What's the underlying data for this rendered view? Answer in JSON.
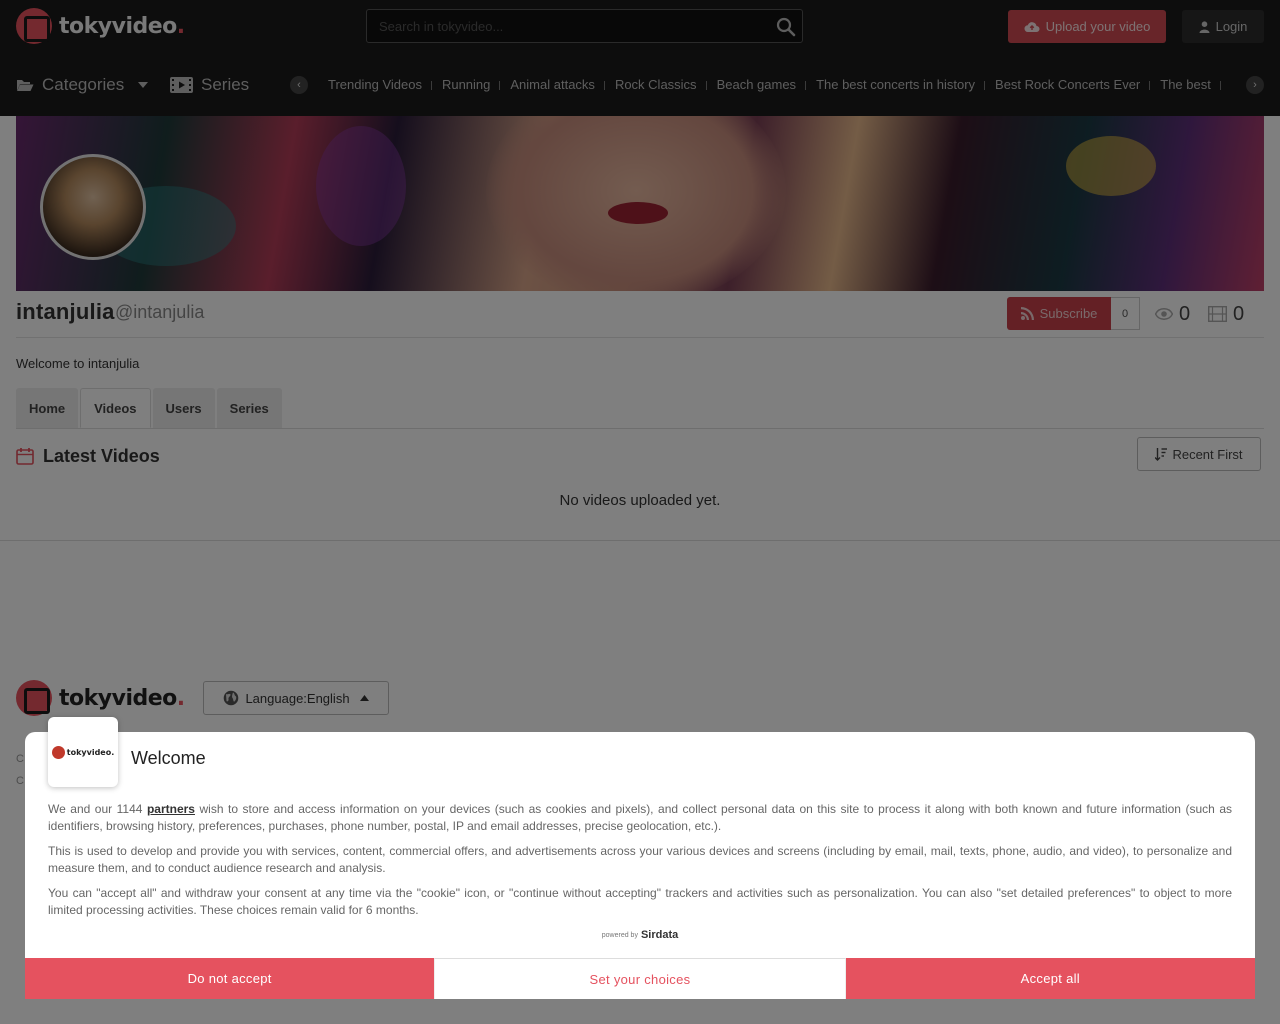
{
  "header": {
    "logo_text": "tokyvideo",
    "logo_dot": ".",
    "search_placeholder": "Search in tokyvideo...",
    "upload_label": "Upload your video",
    "login_label": "Login",
    "categories_label": "Categories",
    "series_label": "Series",
    "chips": [
      "Trending Videos",
      "Running",
      "Animal attacks",
      "Rock Classics",
      "Beach games",
      "The best concerts in history",
      "Best Rock Concerts Ever",
      "The best"
    ]
  },
  "profile": {
    "name": "intanjulia",
    "handle": "@intanjulia",
    "subscribe_label": "Subscribe",
    "subscriber_count": "0",
    "views_count": "0",
    "videos_count": "0",
    "welcome_text": "Welcome to intanjulia"
  },
  "tabs": [
    {
      "label": "Home",
      "active": false
    },
    {
      "label": "Videos",
      "active": true
    },
    {
      "label": "Users",
      "active": false
    },
    {
      "label": "Series",
      "active": false
    }
  ],
  "content": {
    "section_title": "Latest Videos",
    "sort_label": "Recent First",
    "empty_text": "No videos uploaded yet."
  },
  "footer": {
    "language_prefix": "Language:",
    "language_value": "English",
    "line1": "C",
    "line2": "C"
  },
  "consent": {
    "logo_text": "tokyvideo.",
    "title": "Welcome",
    "p1_before": "We and our 1144 ",
    "p1_link": "partners",
    "p1_after": " wish to store and access information on your devices (such as cookies and pixels), and collect personal data on this site to process it along with both known and future information (such as identifiers, browsing history, preferences, purchases, phone number, postal, IP and email addresses, precise geolocation, etc.).",
    "p2": "This is used to develop and provide you with services, content, commercial offers, and advertisements across your various devices and screens (including by email, mail, texts, phone, audio, and video), to personalize and measure them, and to conduct audience research and analysis.",
    "p3": "You can \"accept all\" and withdraw your consent at any time via the \"cookie\" icon, or \"continue without accepting\" trackers and activities such as personalization. You can also \"set detailed preferences\" to object to more limited processing activities. These choices remain valid for 6 months.",
    "powered_by": "powered by",
    "powered_brand": "Sirdata",
    "btn_reject": "Do not accept",
    "btn_choices": "Set your choices",
    "btn_accept": "Accept all"
  },
  "colors": {
    "header_bg": "#1a1a1a",
    "accent": "#e5525f",
    "subscribe": "#c8414a"
  }
}
